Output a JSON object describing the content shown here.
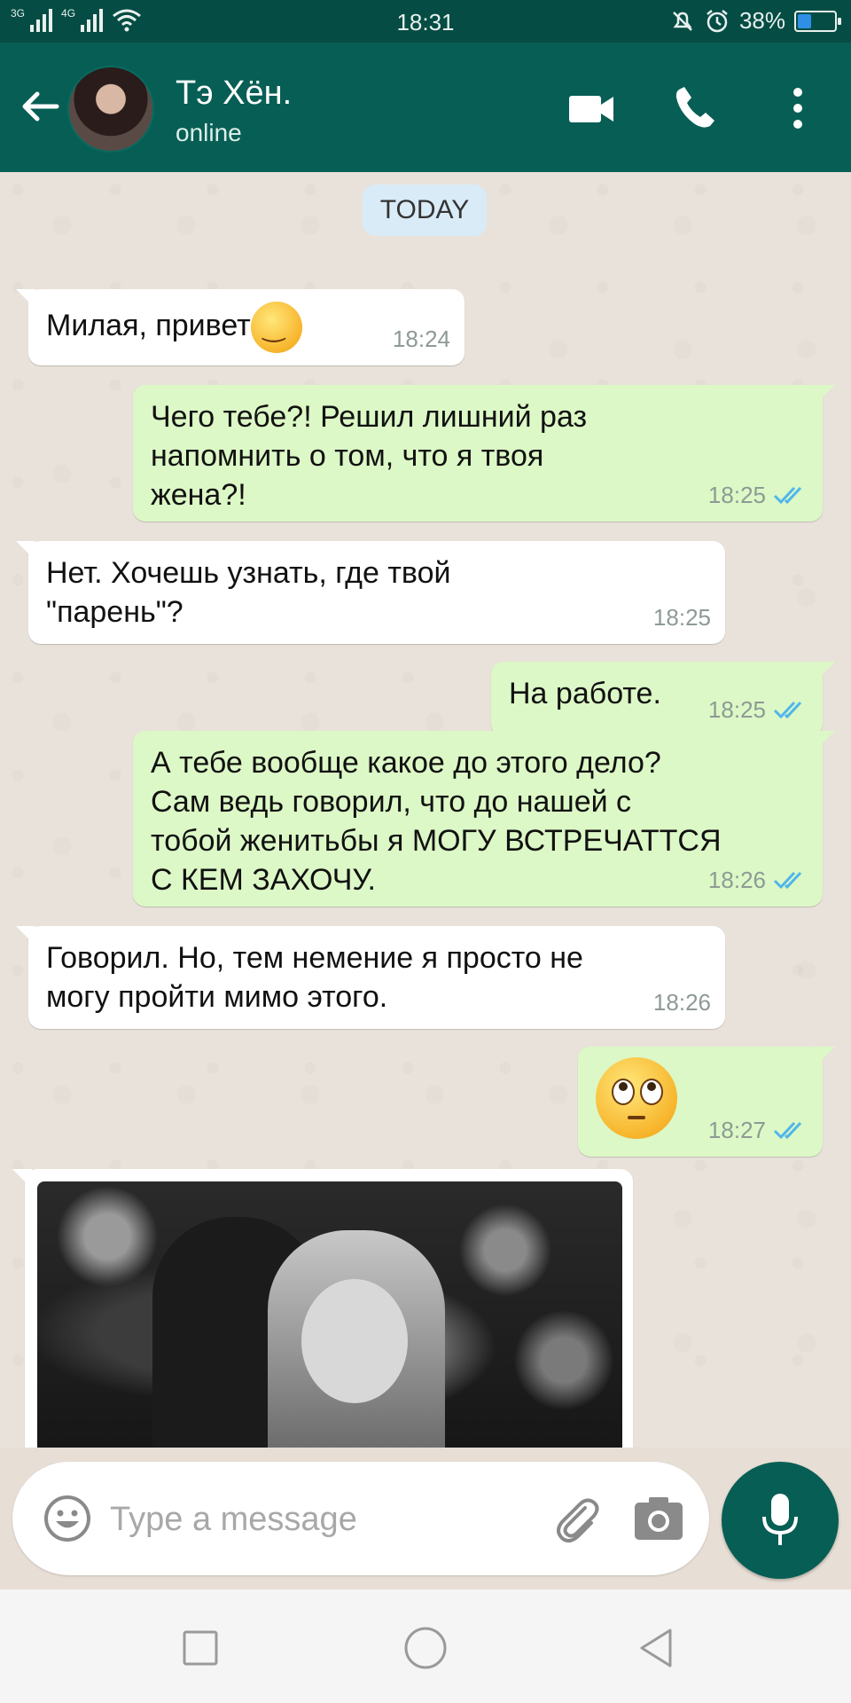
{
  "status_bar": {
    "network_1": "3G",
    "network_2": "4G",
    "time": "18:31",
    "battery": "38%",
    "battery_level": 0.38,
    "icons": [
      "wifi-icon",
      "mute-icon",
      "alarm-icon",
      "battery-icon"
    ]
  },
  "header": {
    "contact_name": "Тэ Хён.",
    "contact_status": "online",
    "icons": [
      "back-arrow-icon",
      "video-call-icon",
      "voice-call-icon",
      "more-vert-icon"
    ]
  },
  "chat": {
    "date_chip": "TODAY",
    "messages": [
      {
        "dir": "in",
        "text": "Милая, привет",
        "emoji": "smiling-face-emoji",
        "time": "18:24"
      },
      {
        "dir": "out",
        "text": "Чего тебе?! Решил лишний раз\nнапомнить о том, что я твоя\nжена?!",
        "time": "18:25",
        "read": true
      },
      {
        "dir": "in",
        "text": "Нет. Хочешь узнать, где твой\n\"парень\"?",
        "time": "18:25"
      },
      {
        "dir": "out",
        "text": "На работе.",
        "time": "18:25",
        "read": true
      },
      {
        "dir": "out",
        "text": "А тебе вообще какое до этого дело?\nСам ведь говорил, что до нашей с\nтобой женитьбы я МОГУ ВСТРЕЧАТТСЯ\nС КЕМ ЗАХОЧУ.",
        "time": "18:26",
        "read": true
      },
      {
        "dir": "in",
        "text": "Говорил. Но, тем немение я просто не\nмогу пройти мимо этого.",
        "time": "18:26"
      },
      {
        "dir": "out",
        "text": "",
        "emoji": "eye-roll-emoji",
        "time": "18:27",
        "read": true
      },
      {
        "dir": "in",
        "type": "photo"
      }
    ]
  },
  "composer": {
    "placeholder": "Type a message",
    "icons": [
      "emoji-icon",
      "attach-icon",
      "camera-icon",
      "mic-icon"
    ]
  },
  "nav": {
    "icons": [
      "recents-square-icon",
      "home-circle-icon",
      "back-triangle-icon"
    ]
  },
  "colors": {
    "header": "#075e54",
    "status_bar": "#054d44",
    "outgoing_bubble": "#dcf8c6",
    "incoming_bubble": "#ffffff",
    "read_ticks": "#4fb6ec"
  }
}
